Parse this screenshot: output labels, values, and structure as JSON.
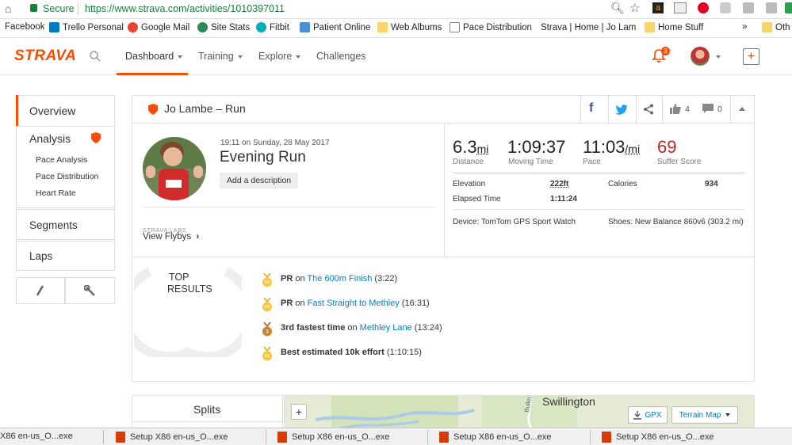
{
  "browser": {
    "secure_label": "Secure",
    "url": "https://www.strava.com/activities/1010397011"
  },
  "bookmarks": {
    "items": [
      "Facebook",
      "Trello Personal",
      "Google Mail",
      "Site Stats",
      "Fitbit",
      "Patient Online",
      "Web Albums",
      "Pace Distribution",
      "Strava | Home | Jo Lam",
      "Home Stuff"
    ],
    "overflow": "»",
    "other_label": "Oth"
  },
  "nav": {
    "logo": "STRAVA",
    "items": [
      "Dashboard",
      "Training",
      "Explore",
      "Challenges"
    ],
    "notification_count": "3",
    "add_symbol": "+"
  },
  "sidebar": {
    "overview": "Overview",
    "analysis": "Analysis",
    "sub_items": [
      "Pace Analysis",
      "Pace Distribution",
      "Heart Rate"
    ],
    "segments": "Segments",
    "laps": "Laps"
  },
  "activity": {
    "header_title": "Jo Lambe – Run",
    "kudos_count": "4",
    "comment_count": "0",
    "timestamp": "19:11 on Sunday, 28 May 2017",
    "name": "Evening Run",
    "add_description": "Add a description",
    "labs_label": "STRAVA LABS",
    "flyby_label": "View Flybys",
    "stats": {
      "distance_value": "6.3",
      "distance_unit": "mi",
      "distance_label": "Distance",
      "moving_time_value": "1:09:37",
      "moving_time_label": "Moving Time",
      "pace_value": "11:03",
      "pace_unit": "/mi",
      "pace_label": "Pace",
      "suffer_value": "69",
      "suffer_label": "Suffer Score"
    },
    "details": {
      "elevation_label": "Elevation",
      "elevation_value": "222ft",
      "calories_label": "Calories",
      "calories_value": "934",
      "elapsed_label": "Elapsed Time",
      "elapsed_value": "1:11:24",
      "device": "Device: TomTom GPS Sport Watch",
      "shoes": "Shoes: New Balance 860v6 (303.2 mi)"
    },
    "top_results_line1": "TOP",
    "top_results_line2": "RESULTS",
    "results": [
      {
        "prefix": "PR",
        "mid": " on ",
        "segment": "The 600m Finish",
        "time": " (3:22)",
        "medal": "PR"
      },
      {
        "prefix": "PR",
        "mid": " on ",
        "segment": "Fast Straight to Methley",
        "time": " (16:31)",
        "medal": "PR"
      },
      {
        "prefix": "3rd fastest time",
        "mid": " on ",
        "segment": "Methley Lane",
        "time": " (13:24)",
        "medal": "3"
      },
      {
        "prefix": "Best estimated 10k effort",
        "mid": "",
        "segment": "",
        "time": " (1:10:15)",
        "medal": "PR"
      }
    ]
  },
  "splits": {
    "label": "Splits",
    "map_place": "Swillington",
    "map_road": "Bullerthorpe",
    "zoom_in": "+",
    "gpx_label": "GPX",
    "terrain_label": "Terrain Map"
  },
  "taskbar": {
    "items": [
      "Setup X86 en-us_O...exe",
      "Setup X86 en-us_O...exe",
      "Setup X86 en-us_O...exe",
      "Setup X86 en-us_O...exe"
    ],
    "left_partial": "X86 en-us_O...exe"
  },
  "colors": {
    "strava_orange": "#fc4c02",
    "link_blue": "#0a7bbd",
    "suffer_red": "#b72a2a",
    "medal_gold": "#e8b13a"
  }
}
